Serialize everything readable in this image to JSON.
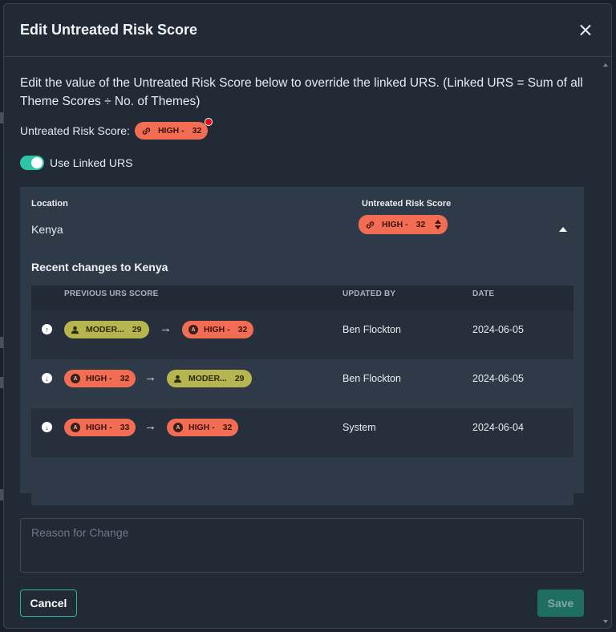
{
  "modal": {
    "title": "Edit Untreated Risk Score",
    "description": "Edit the value of the Untreated Risk Score below to override the linked URS. (Linked URS = Sum of all Theme Scores ÷ No. of Themes)"
  },
  "urs": {
    "label": "Untreated Risk Score:",
    "level": "HIGH -",
    "score": "32"
  },
  "toggle": {
    "label": "Use Linked URS",
    "on": true
  },
  "panel": {
    "location_header": "Location",
    "location_value": "Kenya",
    "urs_header": "Untreated Risk Score",
    "urs_level": "HIGH -",
    "urs_score": "32",
    "recent_title": "Recent changes to Kenya",
    "columns": {
      "previous": "PREVIOUS URS SCORE",
      "updated_by": "UPDATED BY",
      "date": "DATE"
    },
    "rows": [
      {
        "dir": "up",
        "from_level": "MODER...",
        "from_score": "29",
        "to_level": "HIGH -",
        "to_score": "32",
        "updated_by": "Ben Flockton",
        "date": "2024-06-05"
      },
      {
        "dir": "down",
        "from_level": "HIGH -",
        "from_score": "32",
        "to_level": "MODER...",
        "to_score": "29",
        "updated_by": "Ben Flockton",
        "date": "2024-06-05"
      },
      {
        "dir": "down",
        "from_level": "HIGH -",
        "from_score": "33",
        "to_level": "HIGH -",
        "to_score": "32",
        "updated_by": "System",
        "date": "2024-06-04"
      }
    ],
    "arrow": "→",
    "auto_icon": "A"
  },
  "reason": {
    "placeholder": "Reason for Change"
  },
  "buttons": {
    "cancel": "Cancel",
    "save": "Save"
  },
  "colors": {
    "accent": "#2ec4a8",
    "high": "#f26d54",
    "moderate": "#b6b54f",
    "alert": "#e30613"
  }
}
